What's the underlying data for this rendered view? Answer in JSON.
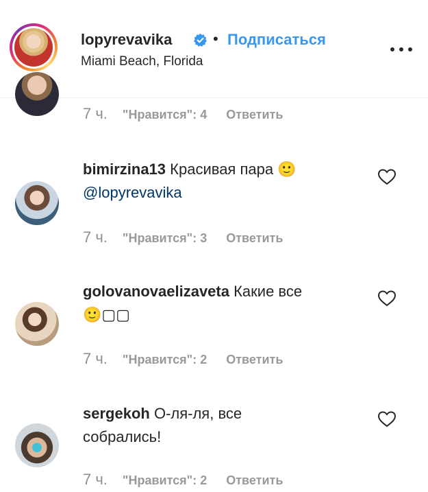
{
  "header": {
    "username": "lopyrevavika",
    "separator": "•",
    "subscribe_label": "Подписаться",
    "location": "Miami Beach, Florida",
    "accent_color": "#3897f0"
  },
  "comments": [
    {
      "username": "",
      "text": "",
      "time": "7 ч.",
      "likes": "\"Нравится\": 4",
      "reply": "Ответить"
    },
    {
      "username": "bimirzina13",
      "text": "Красивая пара 🙂",
      "mention": "@lopyrevavika",
      "time": "7 ч.",
      "likes": "\"Нравится\": 3",
      "reply": "Ответить"
    },
    {
      "username": "golovanovaelizaveta",
      "text": "Какие все",
      "text_line2": "🙂▢▢",
      "time": "7 ч.",
      "likes": "\"Нравится\": 2",
      "reply": "Ответить"
    },
    {
      "username": "sergekoh",
      "text": "О-ля-ля, все",
      "text_line2": "собрались!",
      "time": "7 ч.",
      "likes": "\"Нравится\": 2",
      "reply": "Ответить"
    }
  ]
}
